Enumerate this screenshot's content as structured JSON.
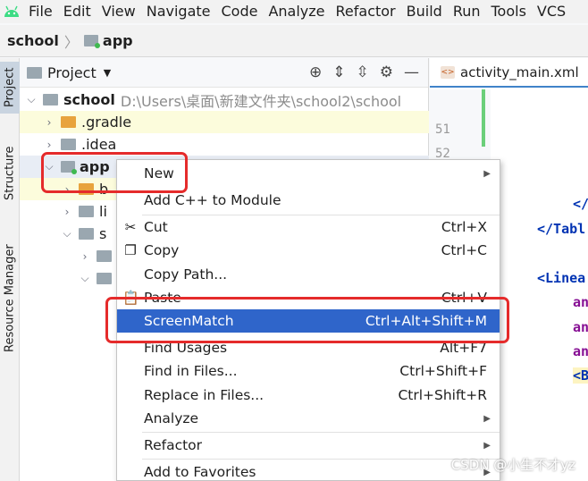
{
  "menubar": {
    "logo": "android-icon",
    "items": [
      {
        "label": "File",
        "mn": "F"
      },
      {
        "label": "Edit",
        "mn": "E"
      },
      {
        "label": "View",
        "mn": "V"
      },
      {
        "label": "Navigate",
        "mn": "N"
      },
      {
        "label": "Code",
        "mn": "C"
      },
      {
        "label": "Analyze",
        "mn": "z"
      },
      {
        "label": "Refactor",
        "mn": "R"
      },
      {
        "label": "Build",
        "mn": "B"
      },
      {
        "label": "Run",
        "mn": "u"
      },
      {
        "label": "Tools",
        "mn": "T"
      },
      {
        "label": "VCS",
        "mn": "S"
      }
    ]
  },
  "breadcrumb": {
    "root": "school",
    "child": "app"
  },
  "strip": {
    "project": "Project",
    "structure": "Structure",
    "resource_manager": "Resource Manager"
  },
  "project_panel": {
    "title": "Project",
    "tree": [
      {
        "name": "school",
        "path": "D:\\Users\\桌面\\新建文件夹\\school2\\school"
      },
      {
        "name": ".gradle"
      },
      {
        "name": ".idea"
      },
      {
        "name": "app"
      },
      {
        "name": "b"
      },
      {
        "name": "li"
      },
      {
        "name": "s"
      }
    ]
  },
  "editor": {
    "tab": "activity_main.xml",
    "line_numbers": [
      "51",
      "52"
    ],
    "code": [
      "</",
      "</Tabl",
      "<Linea",
      "an",
      "an",
      "an",
      "<B"
    ]
  },
  "context_menu": {
    "items": [
      {
        "label": "New",
        "shortcut": "",
        "submenu": true
      },
      {
        "label": "Add C++ to Module",
        "shortcut": ""
      },
      {
        "label": "Cut",
        "shortcut": "Ctrl+X",
        "icon": "scissors-icon"
      },
      {
        "label": "Copy",
        "shortcut": "Ctrl+C",
        "icon": "copy-icon"
      },
      {
        "label": "Copy Path...",
        "shortcut": ""
      },
      {
        "label": "Paste",
        "shortcut": "Ctrl+V",
        "icon": "paste-icon"
      },
      {
        "label": "ScreenMatch",
        "shortcut": "Ctrl+Alt+Shift+M",
        "selected": true
      },
      {
        "label": "Find Usages",
        "shortcut": "Alt+F7"
      },
      {
        "label": "Find in Files...",
        "shortcut": "Ctrl+Shift+F"
      },
      {
        "label": "Replace in Files...",
        "shortcut": "Ctrl+Shift+R"
      },
      {
        "label": "Analyze",
        "shortcut": "",
        "submenu": true
      },
      {
        "label": "Refactor",
        "shortcut": "",
        "submenu": true
      },
      {
        "label": "Add to Favorites",
        "shortcut": "",
        "submenu": true
      }
    ]
  },
  "watermark": "CSDN @小生不才yz",
  "colors": {
    "selection": "#2f65ca",
    "annotation": "#e52b2b"
  }
}
